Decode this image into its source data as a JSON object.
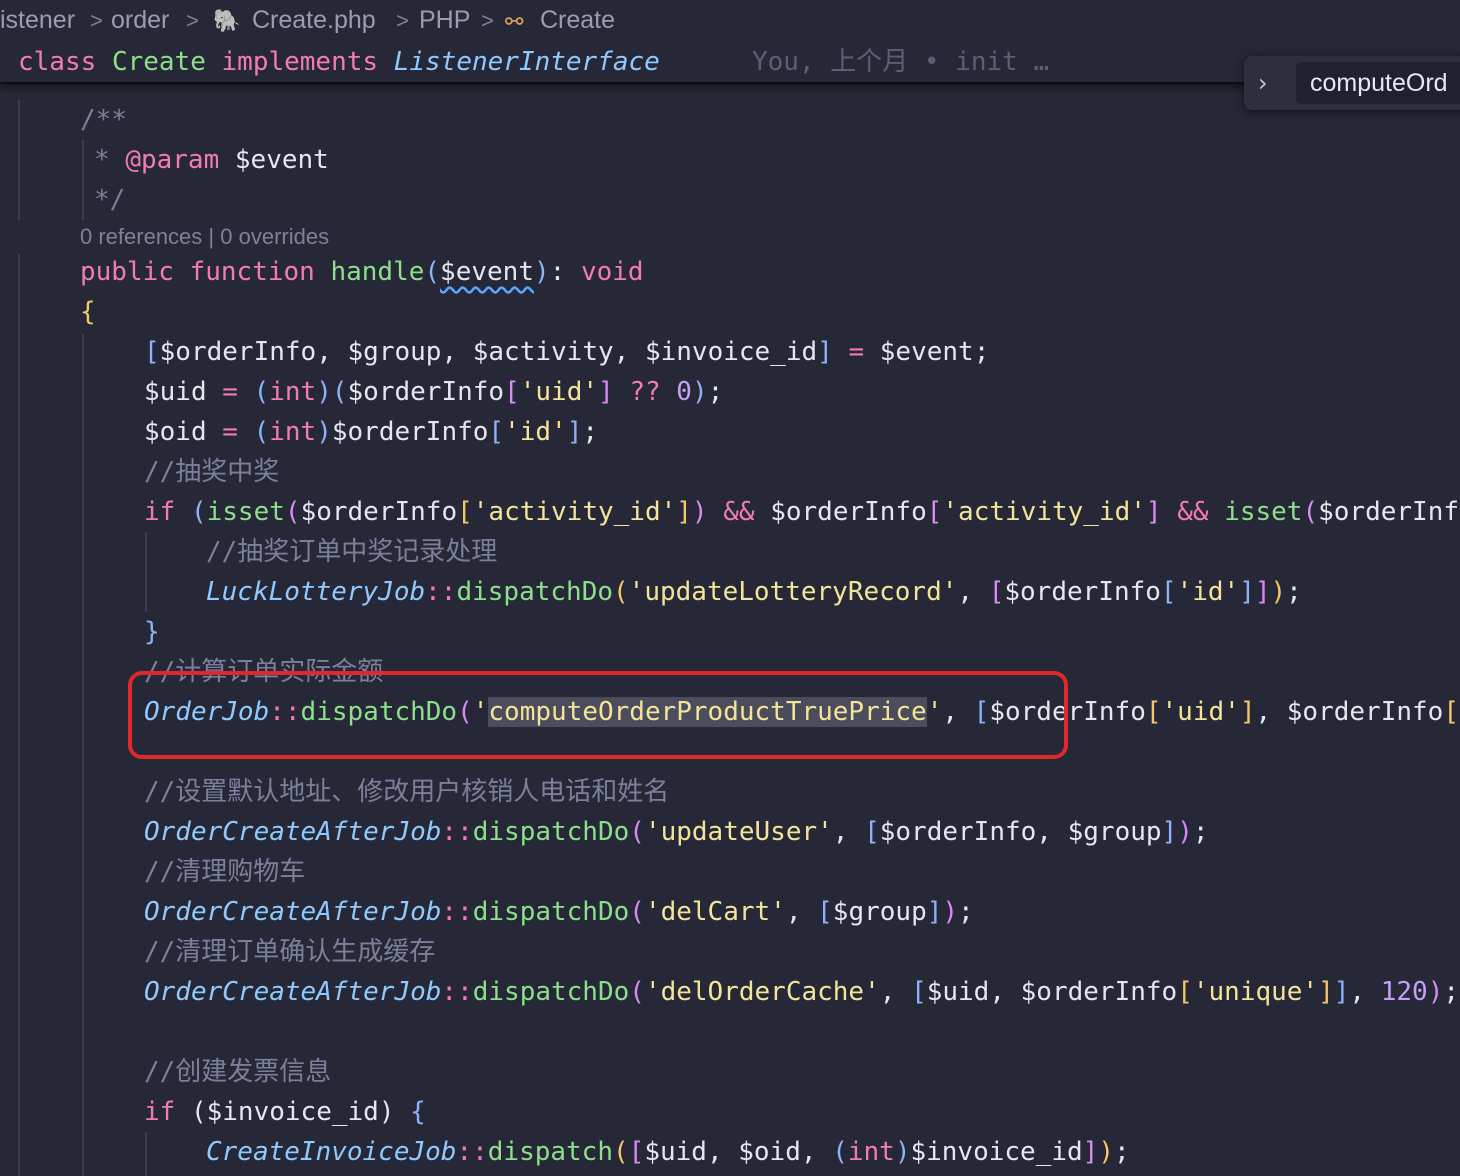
{
  "breadcrumb": {
    "items": [
      "istener",
      "order",
      "Create.php",
      "PHP",
      "Create"
    ],
    "separator": ">",
    "file_icon": "php-elephant-icon",
    "symbol_icon": "class-symbol-icon"
  },
  "sticky_header": {
    "keyword": "class",
    "class_name": "Create",
    "implements": "implements",
    "interface": "ListenerInterface",
    "blame": "You, 上个月 • init …"
  },
  "find_widget": {
    "toggle_icon": "chevron-right-icon",
    "query": "computeOrd"
  },
  "codelens": {
    "references": "0 references",
    "separator": "|",
    "overrides": "0 overrides"
  },
  "code": {
    "doc_open": "/**",
    "doc_param_star": "*",
    "doc_param_tag": "@param",
    "doc_param_var": "$event",
    "doc_close": "*/",
    "sig_public": "public",
    "sig_function": "function",
    "sig_name": "handle",
    "sig_param": "$event",
    "sig_return": "void",
    "open_brace": "{",
    "comments": {
      "lottery": "//抽奖中奖",
      "lottery_record": "//抽奖订单中奖记录处理",
      "compute_price": "//计算订单实际金额",
      "default_address": "//设置默认地址、修改用户核销人电话和姓名",
      "clear_cart": "//清理购物车",
      "clear_cache": "//清理订单确认生成缓存",
      "invoice": "//创建发票信息"
    },
    "classes": {
      "luck": "LuckLotteryJob",
      "order_job": "OrderJob",
      "after": "OrderCreateAfterJob",
      "invoice": "CreateInvoiceJob"
    },
    "methods": {
      "dispatch_do": "dispatchDo",
      "dispatch": "dispatch",
      "isset": "isset"
    },
    "strings": {
      "uid": "'uid'",
      "id": "'id'",
      "activity_id": "'activity_id'",
      "update_lottery": "'updateLotteryRecord'",
      "compute_q": "'",
      "compute_name": "computeOrderProductTruePrice",
      "update_user": "'updateUser'",
      "del_cart": "'delCart'",
      "del_cache": "'delOrderCache'",
      "unique": "'unique'"
    },
    "vars": {
      "order_info": "$orderInfo",
      "group": "$group",
      "activity": "$activity",
      "invoice_id": "$invoice_id",
      "event": "$event",
      "uid": "$uid",
      "oid": "$oid"
    },
    "kw_if": "if",
    "cast_int": "int",
    "coalesce": "??",
    "zero": "0",
    "ttl": "120",
    "and_op": "&&"
  },
  "colors": {
    "background": "#262837",
    "keyword": "#f27cb2",
    "function": "#8ce08a",
    "class": "#8ec9ff",
    "string": "#f4e49a",
    "comment": "#7c7f9b",
    "number": "#c6a0f6",
    "annotation_box": "#e0282c"
  }
}
